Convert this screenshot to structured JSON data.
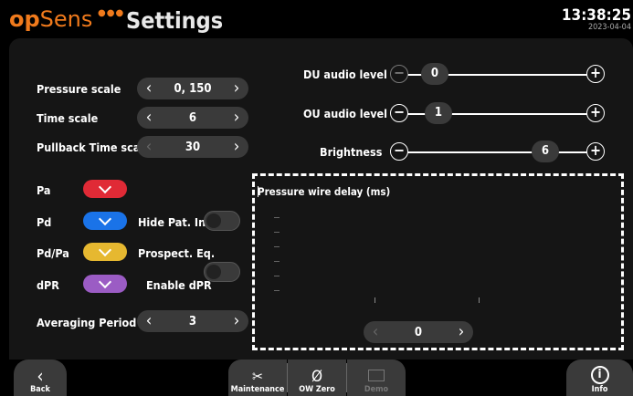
{
  "header": {
    "logo_op": "op",
    "logo_sens": "Sens",
    "title": "Settings",
    "time": "13:38:25",
    "date": "2023-04-04"
  },
  "steppers": {
    "pressure_scale": {
      "label": "Pressure scale",
      "value": "0, 150"
    },
    "time_scale": {
      "label": "Time scale",
      "value": "6"
    },
    "pullback_time_scale": {
      "label": "Pullback Time scale",
      "value": "30"
    },
    "averaging_period": {
      "label": "Averaging Period",
      "value": "3"
    }
  },
  "channels": [
    {
      "label": "Pa",
      "color": "#e02a36"
    },
    {
      "label": "Pd",
      "color": "#1a73e8"
    },
    {
      "label": "Pd/Pa",
      "color": "#e6b830"
    },
    {
      "label": "dPR",
      "color": "#9b5cc4"
    }
  ],
  "toggles": [
    {
      "label": "Hide Pat. Info",
      "on": false
    },
    {
      "label": "Prospect. Eq.",
      "on": false
    },
    {
      "label": "Enable dPR",
      "on": true
    }
  ],
  "sliders": {
    "du_audio": {
      "label": "DU audio level",
      "value": "0",
      "level_fraction": 0.0
    },
    "ou_audio": {
      "label": "OU audio level",
      "value": "1",
      "level_fraction": 0.1
    },
    "brightness": {
      "label": "Brightness",
      "value": "6",
      "level_fraction": 0.85
    }
  },
  "delay_panel": {
    "title": "Pressure wire delay (ms)",
    "value": "0"
  },
  "footer": {
    "back": "Back",
    "maintenance": "Maintenance",
    "ow_zero": "OW Zero",
    "demo": "Demo",
    "info": "Info"
  },
  "icons": {
    "arrow_left": "‹",
    "arrow_right": "›",
    "minus": "−",
    "plus": "+",
    "zero": "Ø",
    "info": "i"
  }
}
